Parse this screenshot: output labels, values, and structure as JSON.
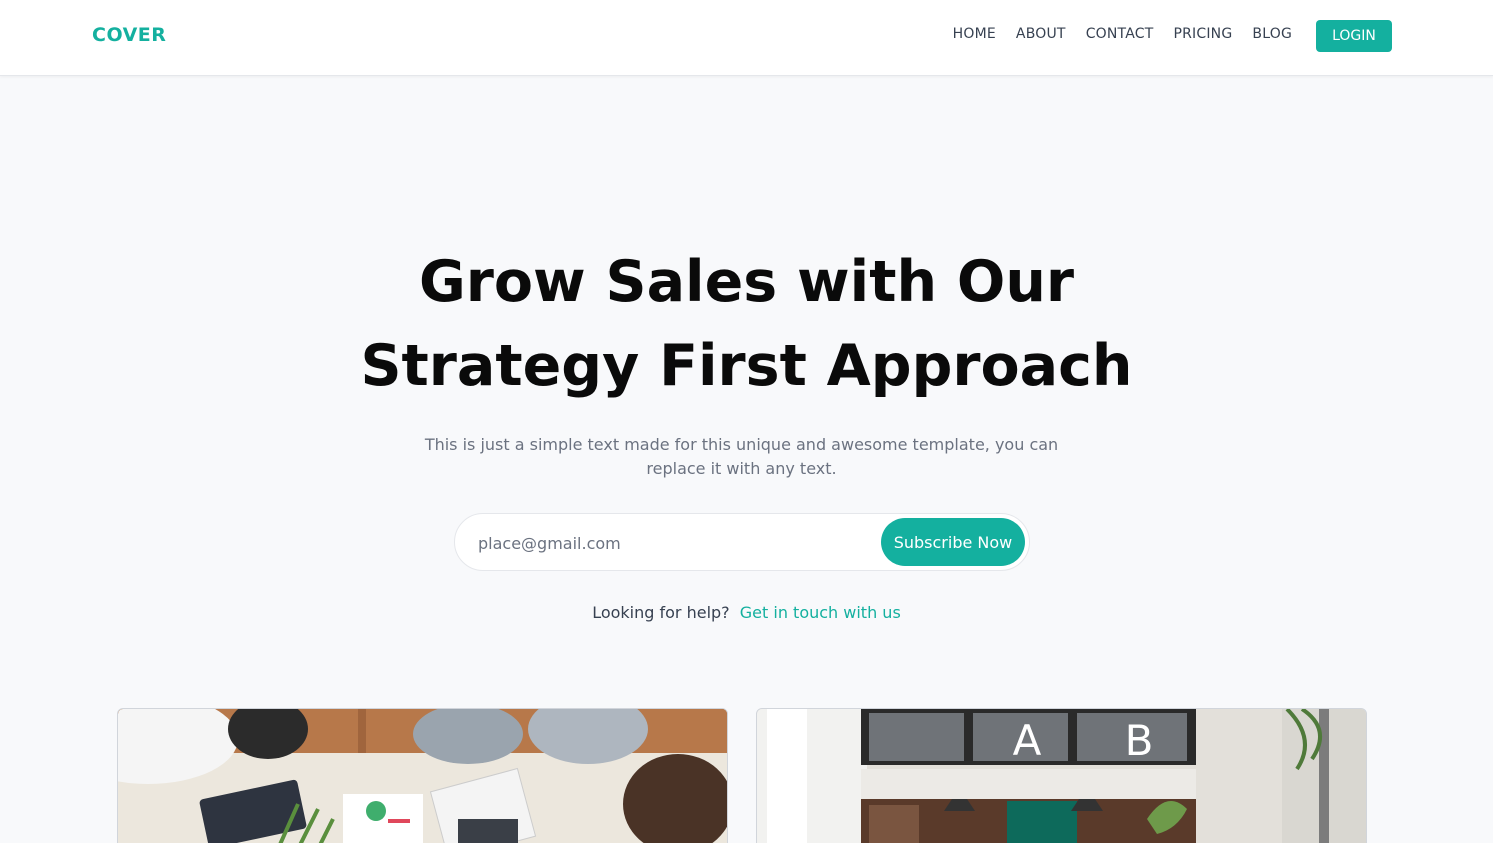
{
  "brand": "COVER",
  "nav": {
    "items": [
      "HOME",
      "ABOUT",
      "CONTACT",
      "PRICING",
      "BLOG"
    ],
    "login_label": "LOGIN"
  },
  "hero": {
    "title": "Grow Sales with Our Strategy First Approach",
    "subtitle": "This is just a simple text made for this unique and awesome template, you can replace it with any text.",
    "email_placeholder": "place@gmail.com",
    "subscribe_label": "Subscribe Now",
    "help_text": "Looking for help?",
    "help_link": "Get in touch with us"
  },
  "cards": [
    {
      "image": "team-meeting-photo"
    },
    {
      "image": "office-interior-photo",
      "sign_letters": [
        "A",
        "B"
      ]
    }
  ],
  "colors": {
    "accent": "#14b09f",
    "background": "#f8f9fb",
    "heading": "#0a0a0a",
    "muted": "#6b7280"
  }
}
